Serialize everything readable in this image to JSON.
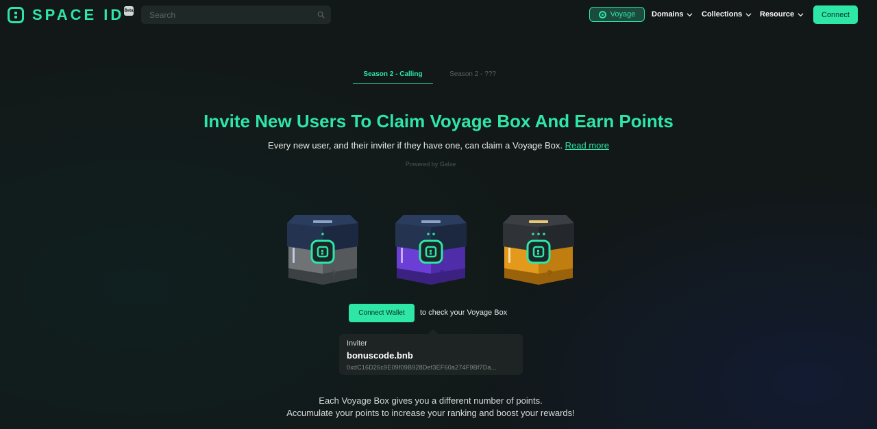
{
  "header": {
    "logo_text": "SPACE ID",
    "beta_label": "Beta",
    "search_placeholder": "Search",
    "nav": {
      "voyage": "Voyage",
      "domains": "Domains",
      "collections": "Collections",
      "resource": "Resource"
    },
    "connect_label": "Connect"
  },
  "tabs": [
    {
      "label": "Season 2 - Calling",
      "active": true
    },
    {
      "label": "Season 2 - ???",
      "active": false
    }
  ],
  "hero": {
    "title": "Invite New Users To Claim Voyage Box And Earn Points",
    "subtitle": "Every new user, and their inviter if they have one, can claim a Voyage Box.",
    "read_more": "Read more",
    "powered_by": "Powered by Galxe"
  },
  "boxes": [
    {
      "name": "gray-box",
      "color": "#6f7375",
      "question_mark": "?"
    },
    {
      "name": "purple-box",
      "color": "#6b3fd6",
      "question_mark": "?"
    },
    {
      "name": "gold-box",
      "color": "#e39a1c",
      "question_mark": "?"
    }
  ],
  "wallet": {
    "button_label": "Connect Wallet",
    "hint": "to check your Voyage Box"
  },
  "inviter": {
    "label": "Inviter",
    "name": "bonuscode.bnb",
    "address": "0xdC16D26c9E09f09B928Def3EF60a274F9Bf7Da..."
  },
  "info": {
    "line1": "Each Voyage Box gives you a different number of points.",
    "line2": "Accumulate your points to increase your ranking and boost your rewards!"
  },
  "colors": {
    "accent": "#2ee6a6",
    "background": "#121818",
    "card": "#1e2424"
  }
}
